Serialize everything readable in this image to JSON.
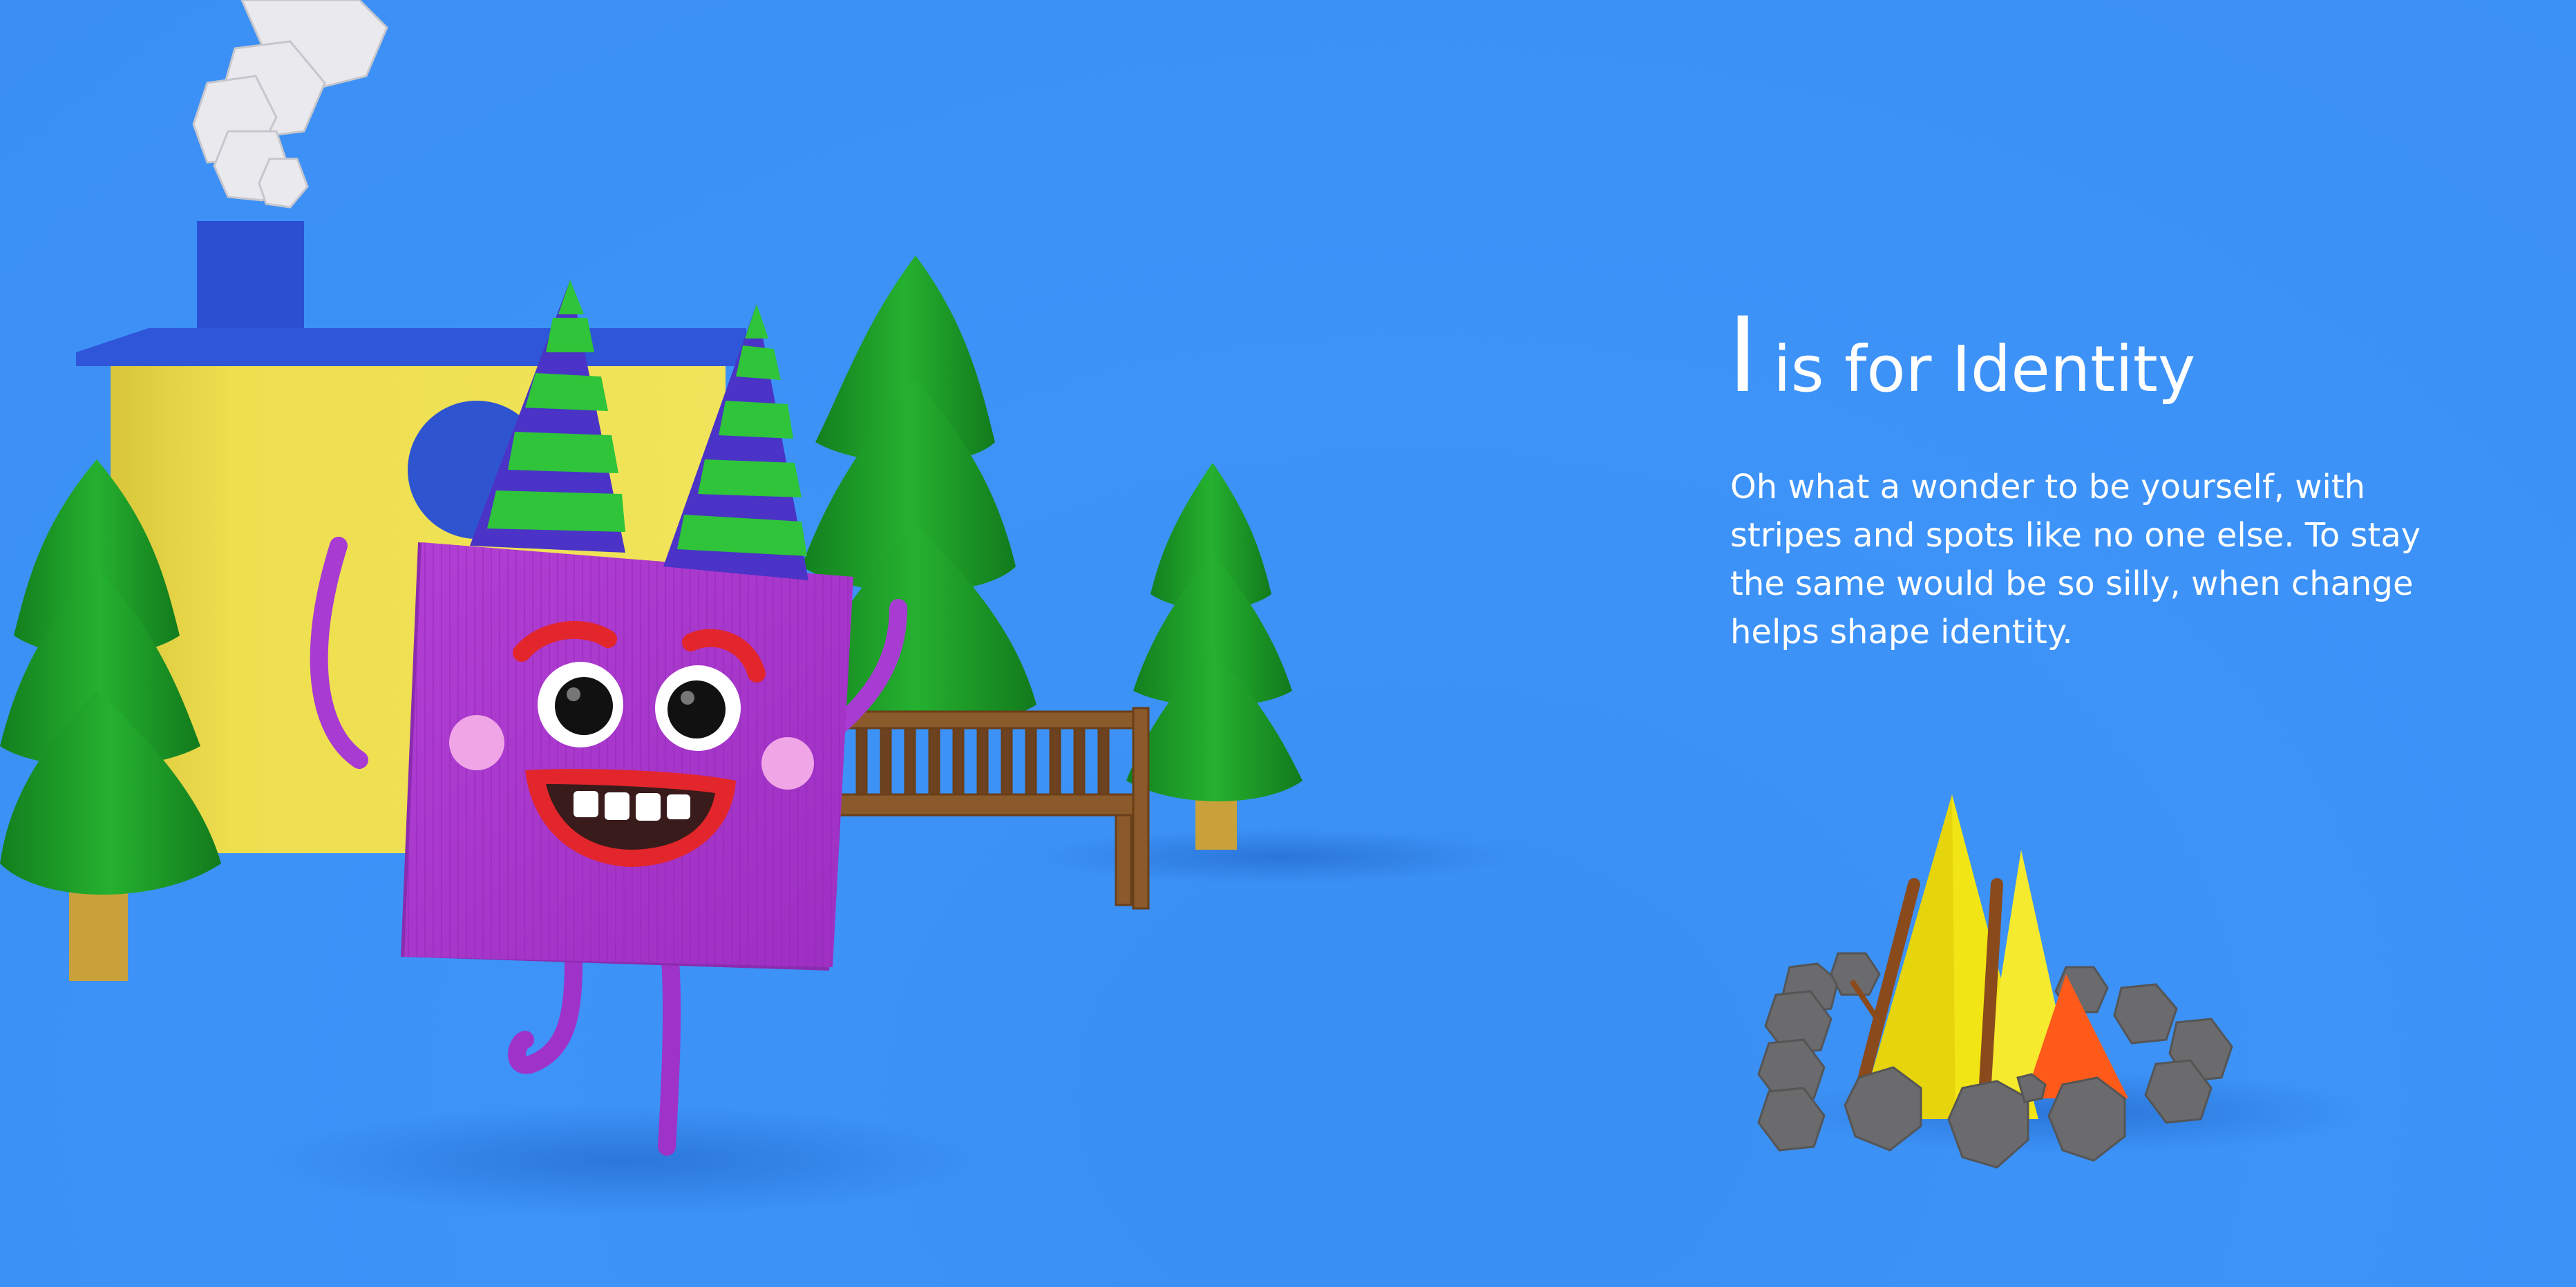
{
  "page": {
    "background_color": "#3d92f7",
    "heading_letter": "I",
    "heading_rest": "is for Identity",
    "body": "Oh what a wonder to be yourself, with stripes and spots like no one else. To stay the same would be so silly, when change helps shape identity."
  },
  "illustration": {
    "elements": [
      "smoke-puffs",
      "yellow-house",
      "pine-trees",
      "purple-square-character",
      "party-hats",
      "wooden-bench",
      "campfire",
      "stone-ring"
    ]
  },
  "colors": {
    "sky": "#3d92f7",
    "character": "#a735c9",
    "hat_stripe_a": "#4b35c4",
    "hat_stripe_b": "#2fc43a",
    "house": "#e9d843",
    "roof": "#2b50c9",
    "tree": "#1b9a26",
    "fire": "#f2e515",
    "flame": "#ff5a1a",
    "stone": "#6a6a6a"
  }
}
